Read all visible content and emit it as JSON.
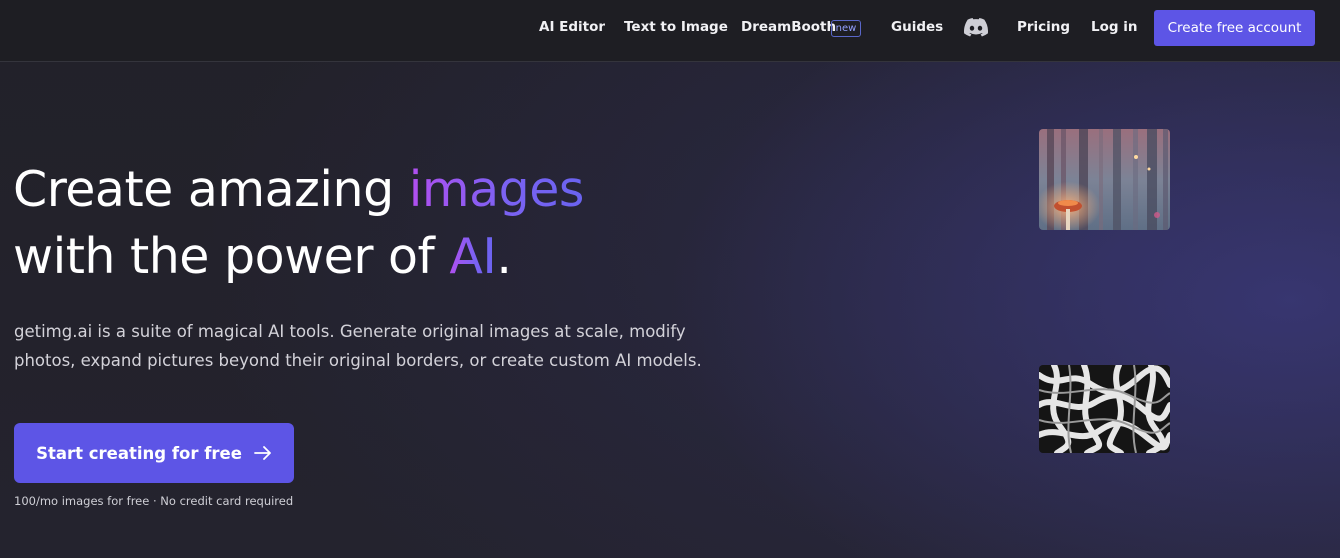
{
  "nav": {
    "links": [
      {
        "label": "AI Editor"
      },
      {
        "label": "Text to Image"
      },
      {
        "label": "DreamBooth"
      },
      {
        "label": "Guides"
      },
      {
        "label": "Pricing"
      },
      {
        "label": "Log in"
      }
    ],
    "badge": "new",
    "discord_icon": "discord-icon",
    "cta": "Create free account"
  },
  "hero": {
    "line1_prefix": "Create amazing ",
    "line1_highlight": "images",
    "line2_prefix": "with the power of ",
    "line2_highlight": "AI",
    "line2_suffix": ".",
    "description": "getimg.ai is a suite of magical AI tools. Generate original images at scale, modify photos, expand pictures beyond their original borders, or create custom AI models.",
    "cta": "Start creating for free",
    "cta_icon": "arrow-right-icon",
    "note": "100/mo images for free · No credit card required"
  },
  "colors": {
    "accent": "#5d55e6",
    "gradient_start": "#b24ff0",
    "gradient_end": "#6a63f0",
    "nav_bg": "#1e1e23",
    "page_bg": "#24232e"
  }
}
